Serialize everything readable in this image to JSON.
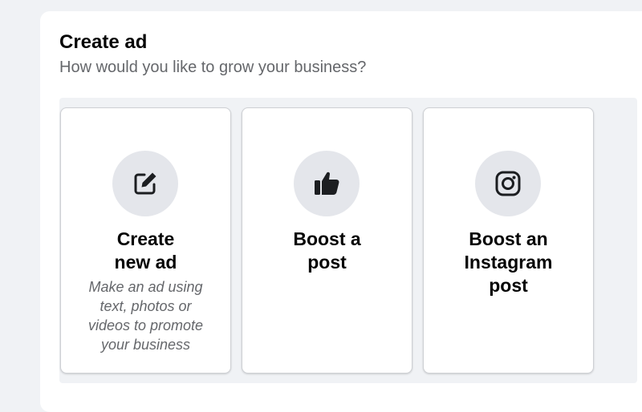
{
  "header": {
    "title": "Create ad",
    "subtitle": "How would you like to grow your business?"
  },
  "cards": [
    {
      "icon": "edit-icon",
      "title_line1": "Create",
      "title_line2": "new ad",
      "description": "Make an ad using text, photos or videos to promote your business"
    },
    {
      "icon": "thumbs-up-icon",
      "title_line1": "Boost a",
      "title_line2": "post"
    },
    {
      "icon": "instagram-icon",
      "title_line1": "Boost an",
      "title_line2": "Instagram",
      "title_line3": "post"
    }
  ],
  "colors": {
    "page_background": "#f0f2f5",
    "card_background": "#ffffff",
    "icon_circle": "#e4e6eb",
    "primary_text": "#050505",
    "secondary_text": "#65676b"
  }
}
